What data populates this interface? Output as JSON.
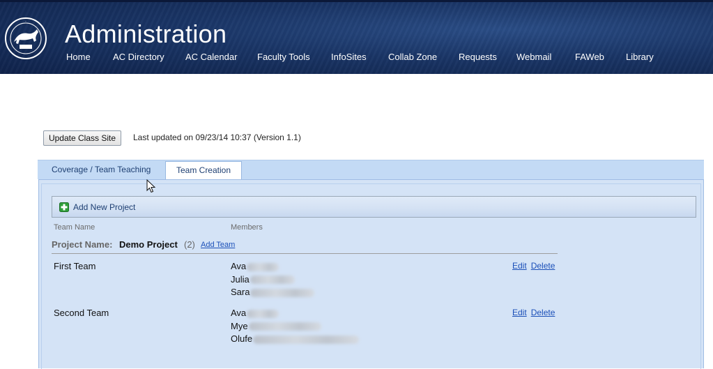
{
  "header": {
    "title": "Administration",
    "logo_icon": "college-seal-icon",
    "nav": [
      {
        "label": "Home"
      },
      {
        "label": "AC Directory"
      },
      {
        "label": "AC Calendar"
      },
      {
        "label": "Faculty Tools"
      },
      {
        "label": "InfoSites"
      },
      {
        "label": "Collab Zone"
      },
      {
        "label": "Requests"
      },
      {
        "label": "Webmail"
      },
      {
        "label": "FAWeb"
      },
      {
        "label": "Library"
      }
    ]
  },
  "toolbar": {
    "update_label": "Update Class Site",
    "last_updated": "Last updated on 09/23/14 10:37 (Version 1.1)"
  },
  "tabs": [
    {
      "label": "Coverage / Team Teaching",
      "active": false
    },
    {
      "label": "Team Creation",
      "active": true
    }
  ],
  "panel": {
    "add_project_label": "Add New Project",
    "add_project_icon": "plus-icon",
    "columns": {
      "team": "Team Name",
      "members": "Members"
    },
    "project": {
      "label": "Project Name:",
      "name": "Demo Project",
      "count": "(2)",
      "add_team_label": "Add Team"
    },
    "teams": [
      {
        "name": "First Team",
        "members": [
          "Ava",
          "Julia",
          "Sara"
        ],
        "edit_label": "Edit",
        "delete_label": "Delete"
      },
      {
        "name": "Second Team",
        "members": [
          "Ava",
          "Mye",
          "Olufe"
        ],
        "edit_label": "Edit",
        "delete_label": "Delete"
      }
    ]
  },
  "colors": {
    "header_bg": "#1a3566",
    "tab_bar": "#c3daf5",
    "panel_bg": "#d4e3f6",
    "link": "#1a4fb8",
    "plus_green": "#2e9e3a"
  }
}
